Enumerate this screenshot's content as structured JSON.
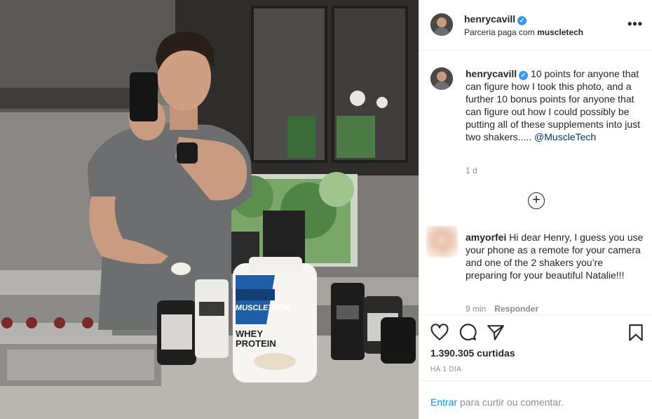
{
  "post": {
    "account": {
      "username": "henrycavill",
      "verified": true,
      "partnership_prefix": "Parceria paga com",
      "partner": "muscletech"
    },
    "photo": {
      "tub_brand": "MUSCLETECH",
      "tub_product_line1": "WHEY",
      "tub_product_line2": "PROTEIN"
    },
    "caption": {
      "username": "henrycavill",
      "text": "10 points for anyone that can figure how I took this photo, and a further 10 bonus points for anyone that can figure out how I could possibly be putting all of these supplements into just two shakers.....",
      "mention": "@MuscleTech",
      "age": "1 d"
    },
    "comments": [
      {
        "username": "amyorfei",
        "text": "Hi dear Henry, I guess you use your phone as a remote for your camera and one of the 2 shakers you’re preparing for your beautiful Natalie!!!",
        "time": "9 min",
        "reply_label": "Responder"
      }
    ],
    "likes": "1.390.305 curtidas",
    "date": "HÁ 1 DIA",
    "login": {
      "link": "Entrar",
      "text": "para curtir ou comentar."
    },
    "icons": {
      "more": "more-dots-icon",
      "like": "heart-icon",
      "comment": "comment-icon",
      "share": "share-icon",
      "save": "bookmark-icon",
      "load_more": "plus-circle-icon"
    },
    "colors": {
      "link": "#00376b",
      "login_link": "#0095f6",
      "verified": "#3897f0",
      "muted": "#8e8e8e",
      "brand_blue": "#1f5fa8"
    }
  }
}
